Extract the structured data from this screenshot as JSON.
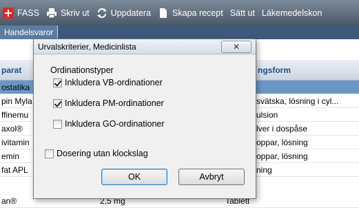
{
  "toolbar": {
    "items": [
      {
        "label": "FASS",
        "icon": "fass-icon"
      },
      {
        "label": "Skriv ut",
        "icon": "printer-icon"
      },
      {
        "label": "Uppdatera",
        "icon": "refresh-icon"
      },
      {
        "label": "Skapa recept",
        "icon": "document-icon"
      },
      {
        "label": "Sätt ut",
        "icon": ""
      },
      {
        "label": "Läkemedelskon",
        "icon": ""
      }
    ]
  },
  "tabs": {
    "active": "Handelsvaror"
  },
  "grid": {
    "headers": [
      "parat",
      "ngsform"
    ],
    "rows": [
      {
        "name": "",
        "col2": "",
        "col3": ""
      },
      {
        "name": "ostatika",
        "col2": "",
        "col3": ""
      },
      {
        "name": "pin Myla",
        "col2": "",
        "col3": "svätska, lösning i cyl..."
      },
      {
        "name": "ffinemu",
        "col2": "",
        "col3": "ulsion"
      },
      {
        "name": "axol®",
        "col2": "",
        "col3": "lver i dospåse"
      },
      {
        "name": "ivitamin",
        "col2": "",
        "col3": "oppar, lösning"
      },
      {
        "name": "emin",
        "col2": "",
        "col3": "oppar, lösning"
      },
      {
        "name": "fat APL",
        "col2": "",
        "col3": "ning"
      },
      {
        "name": "an®",
        "col2": "2,5 mg",
        "col3": "Tablett"
      }
    ]
  },
  "dialog": {
    "title": "Urvalskriterier, Medicinlista",
    "close_label": "✕",
    "group_label": "Ordinationstyper",
    "options": [
      {
        "label": "Inkludera VB-ordinationer",
        "checked": true
      },
      {
        "label": "Inkludera PM-ordinationer",
        "checked": true
      },
      {
        "label": "Inkludera GO-ordinationer",
        "checked": false
      }
    ],
    "dosering": {
      "label": "Dosering utan klockslag",
      "checked": false
    },
    "ok_label": "OK",
    "cancel_label": "Avbryt"
  }
}
